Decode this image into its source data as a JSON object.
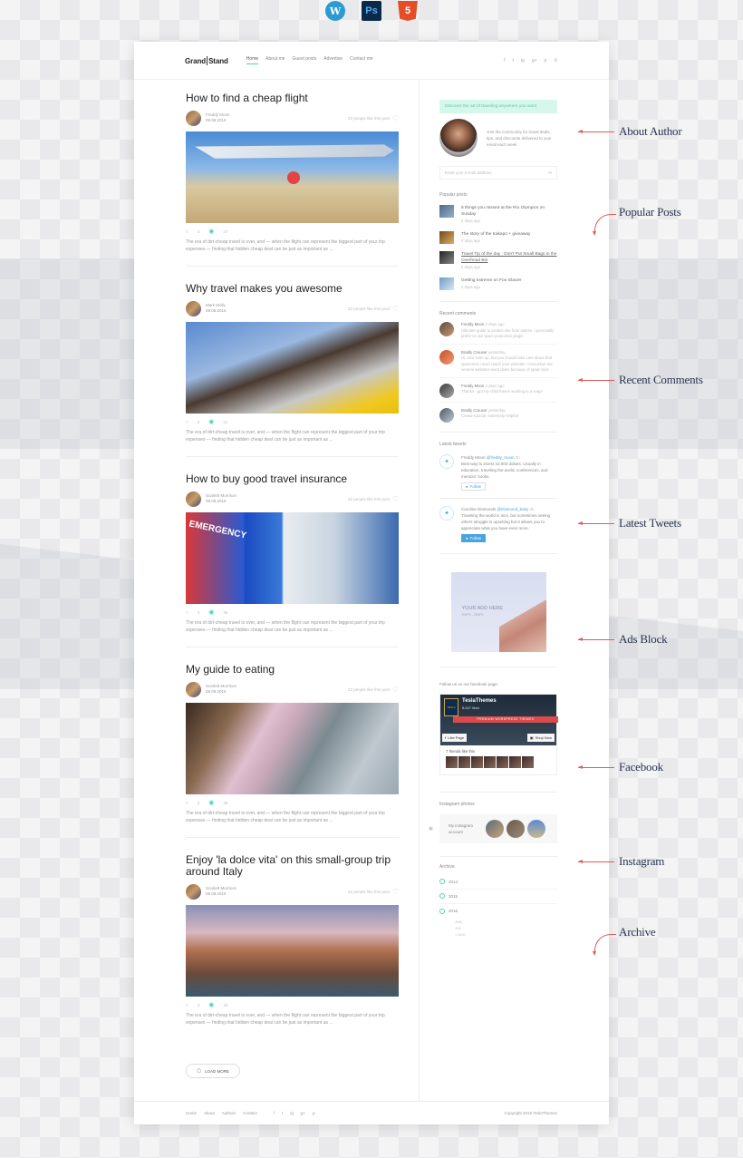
{
  "tech_icons": [
    {
      "name": "wordpress",
      "label": "W"
    },
    {
      "name": "photoshop",
      "label": "Ps"
    },
    {
      "name": "html5",
      "label": "5"
    }
  ],
  "header": {
    "logo_left": "Grand",
    "logo_right": "Stand",
    "nav": [
      "Home",
      "About me",
      "Guest posts",
      "Advertise",
      "Contact me"
    ],
    "active_nav": "Home",
    "social": [
      "f",
      "t",
      "ig",
      "g+",
      "p"
    ],
    "search_icon": "search-icon"
  },
  "posts": [
    {
      "title": "How to find a cheap flight",
      "author": "Freddy Moon",
      "date": "09.08.2016",
      "likes": "22 people like this post",
      "comments": "3",
      "views": "37",
      "excerpt": "The era of dirt-cheap travel is over, and — when the flight can represent the biggest part of your trip expenses — finding that hidden cheap deal can be just as important as ...",
      "image": "airplane over beach"
    },
    {
      "title": "Why travel makes you awesome",
      "author": "Mark Molly",
      "date": "09.08.2016",
      "likes": "22 people like this post",
      "comments": "3",
      "views": "21",
      "excerpt": "The era of dirt-cheap travel is over, and — when the flight can represent the biggest part of your trip expenses — finding that hidden cheap deal can be just as important as ...",
      "image": "hot air balloon"
    },
    {
      "title": "How to buy good travel insurance",
      "author": "Scarlett Morrison",
      "date": "09.08.2016",
      "likes": "22 people like this post",
      "comments": "3",
      "views": "36",
      "excerpt": "The era of dirt-cheap travel is over, and — when the flight can represent the biggest part of your trip expenses — finding that hidden cheap deal can be just as important as ...",
      "image": "hospital emergency sign"
    },
    {
      "title": "My guide to eating",
      "author": "Scarlett Morrison",
      "date": "09.08.2016",
      "likes": "22 people like this post",
      "comments": "3",
      "views": "35",
      "excerpt": "The era of dirt-cheap travel is over, and — when the flight can represent the biggest part of your trip expenses — finding that hidden cheap deal can be just as important as ...",
      "image": "street food market"
    },
    {
      "title": "Enjoy 'la dolce vita' on this small-group trip around Italy",
      "author": "Scarlett Morrison",
      "date": "09.08.2016",
      "likes": "22 people like this post",
      "comments": "3",
      "views": "32",
      "excerpt": "The era of dirt-cheap travel is over, and — when the flight can represent the biggest part of your trip expenses — finding that hidden cheap deal can be just as important as ...",
      "image": "cinque terre coast"
    }
  ],
  "load_more": "LOAD MORE",
  "sidebar": {
    "discover": "Discover the art of traveling anywhere you want",
    "about_text": "Join the community for travel deals, tips, and discounts delivered to your email each week",
    "email_placeholder": "Enter your e-mail address",
    "popular_title": "Popular posts",
    "popular": [
      {
        "title": "6 things you missed at the Rio Olympics on Sunday",
        "ago": "2 days ago"
      },
      {
        "title": "The story of the Kakapo + giveaway",
        "ago": "2 days ago"
      },
      {
        "title": "Travel Tip of the day : Don't Put Small Bags in the Overhead Bin",
        "ago": "2 days ago"
      },
      {
        "title": "Getting extreme on Fox Glacier",
        "ago": "2 days ago"
      }
    ],
    "comments_title": "Recent comments",
    "comments": [
      {
        "name": "Freddy Moon",
        "when": "2 days ago",
        "text": "Ultimate guide to protect site from spams. I personally prefer to use spam protection plugin"
      },
      {
        "name": "Bradly Crouser",
        "when": "yesterday",
        "text": "Hi, nice write up, but you should take care about that spammers never reach your website! I remember me several websites went down because of spam bots"
      },
      {
        "name": "Freddy Moon",
        "when": "2 days ago",
        "text": "Thanks - got my child theme working in a snap!"
      },
      {
        "name": "Bradly Crouser",
        "when": "yesterday",
        "text": "Create tutorial, extremely helpful!"
      }
    ],
    "tweets_title": "Latest tweets",
    "tweets": [
      {
        "name": "Freddy Moon",
        "handle": "@freddy_moon",
        "when": "2h",
        "text": "Best way to invest 10,000 dollars. Usually in education, traveling the world, conferences, and mentors' books.",
        "follow": "Follow",
        "following": false
      },
      {
        "name": "Caroline Diamonds",
        "handle": "@Diamond_baby",
        "when": "2h",
        "text": "Traveling the world is nice, but sometimes seeing others struggle is upsetting but it allows you to appreciate what you have even more.",
        "follow": "Follow",
        "following": true
      }
    ],
    "ad_text": "YOUR ADD HERE",
    "ad_size": "300PX - 250PX",
    "facebook_title": "Follow us on our facebook page :",
    "fb_page": "TeslaThemes",
    "fb_likes": "8,647 likes",
    "fb_banner": "PREMIUM WORDPRESS THEMES",
    "fb_like_btn": "Like Page",
    "fb_shop_btn": "Shop Now",
    "fb_friends": "7 friends like this",
    "fb_logo": "TESLA",
    "instagram_title": "Instagram photos",
    "instagram_text": "My instagram account",
    "archive_title": "Archive",
    "archive": [
      "2014",
      "2015",
      "2016"
    ],
    "months": [
      "JUN",
      "JUL",
      "AUG"
    ]
  },
  "footer": {
    "links": [
      "Home",
      "About",
      "Authors",
      "Contact"
    ],
    "social": [
      "f",
      "t",
      "ig",
      "g+",
      "p"
    ],
    "copyright": "Copyright 2016 TeslaThemes"
  },
  "annotations": [
    "About Author",
    "Popular Posts",
    "Recent Comments",
    "Latest Tweets",
    "Ads Block",
    "Facebook",
    "Instagram",
    "Archive"
  ],
  "colors": {
    "accent": "#4fd1b5",
    "annotation_arrow": "#e25a5a",
    "twitter": "#4aa4e0"
  }
}
